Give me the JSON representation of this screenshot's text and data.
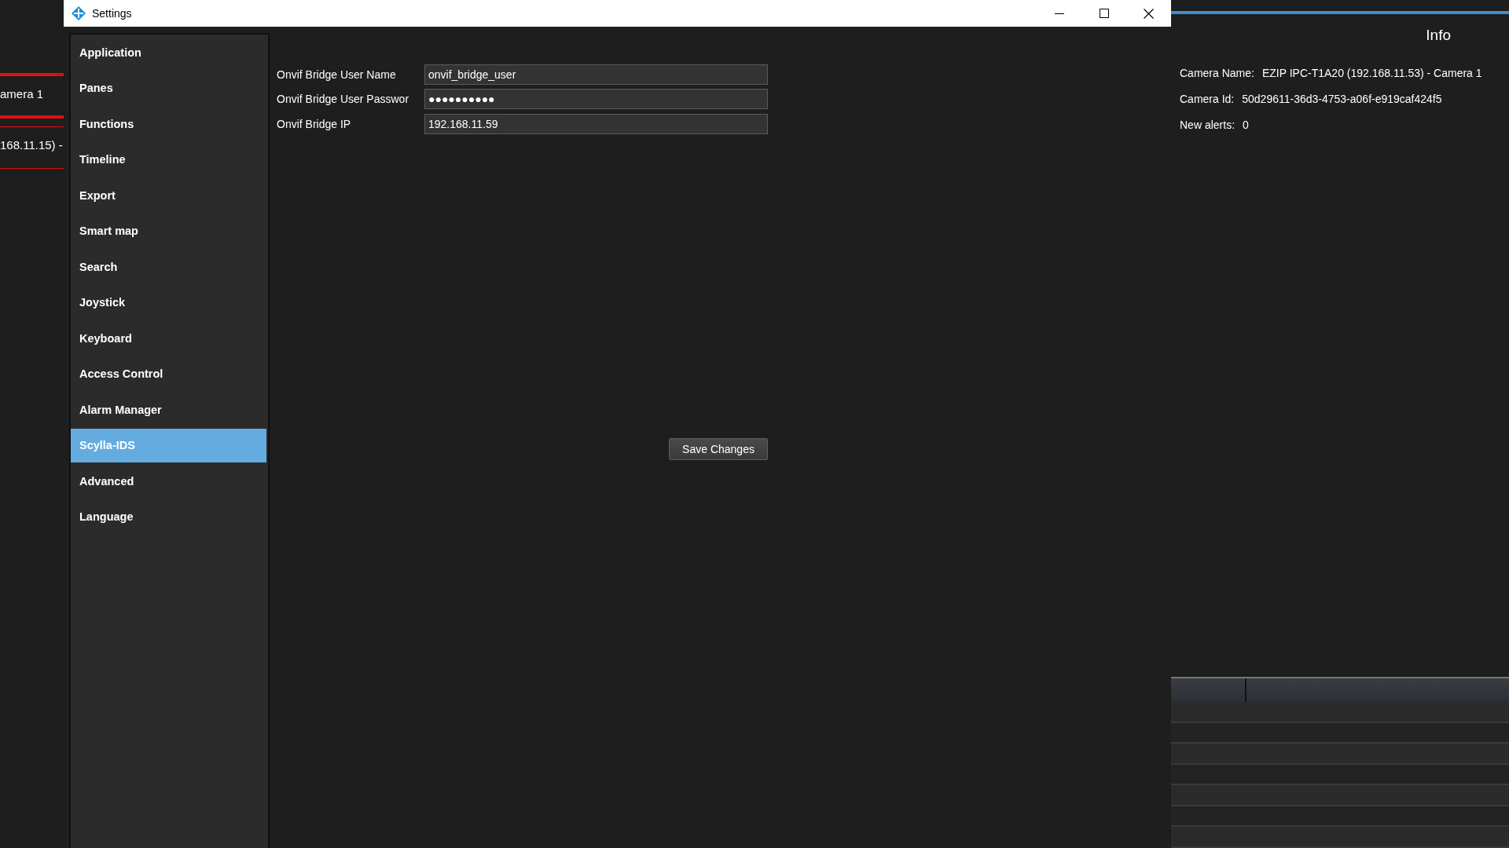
{
  "background_app": {
    "camera_list": [
      "amera 1",
      "168.11.15) -"
    ],
    "info_panel": {
      "title": "Info",
      "fields": [
        {
          "label": "Camera Name:",
          "value": "EZIP IPC-T1A20 (192.168.11.53) - Camera 1"
        },
        {
          "label": "Camera Id:",
          "value": "50d29611-36d3-4753-a06f-e919caf424f5"
        },
        {
          "label": "New alerts:",
          "value": "0"
        }
      ]
    }
  },
  "window": {
    "title": "Settings",
    "sidebar": {
      "items": [
        {
          "label": "Application",
          "selected": false
        },
        {
          "label": "Panes",
          "selected": false
        },
        {
          "label": "Functions",
          "selected": false
        },
        {
          "label": "Timeline",
          "selected": false
        },
        {
          "label": "Export",
          "selected": false
        },
        {
          "label": "Smart map",
          "selected": false
        },
        {
          "label": "Search",
          "selected": false
        },
        {
          "label": "Joystick",
          "selected": false
        },
        {
          "label": "Keyboard",
          "selected": false
        },
        {
          "label": "Access Control",
          "selected": false
        },
        {
          "label": "Alarm Manager",
          "selected": false
        },
        {
          "label": "Scylla-IDS",
          "selected": true
        },
        {
          "label": "Advanced",
          "selected": false
        },
        {
          "label": "Language",
          "selected": false
        }
      ]
    },
    "form": {
      "fields": [
        {
          "label": "Onvif Bridge User Name",
          "value": "onvif_bridge_user"
        },
        {
          "label": "Onvif Bridge User Passwor",
          "value": "●●●●●●●●●●"
        },
        {
          "label": "Onvif Bridge IP",
          "value": "192.168.11.59"
        }
      ],
      "button": "Save Changes"
    }
  }
}
